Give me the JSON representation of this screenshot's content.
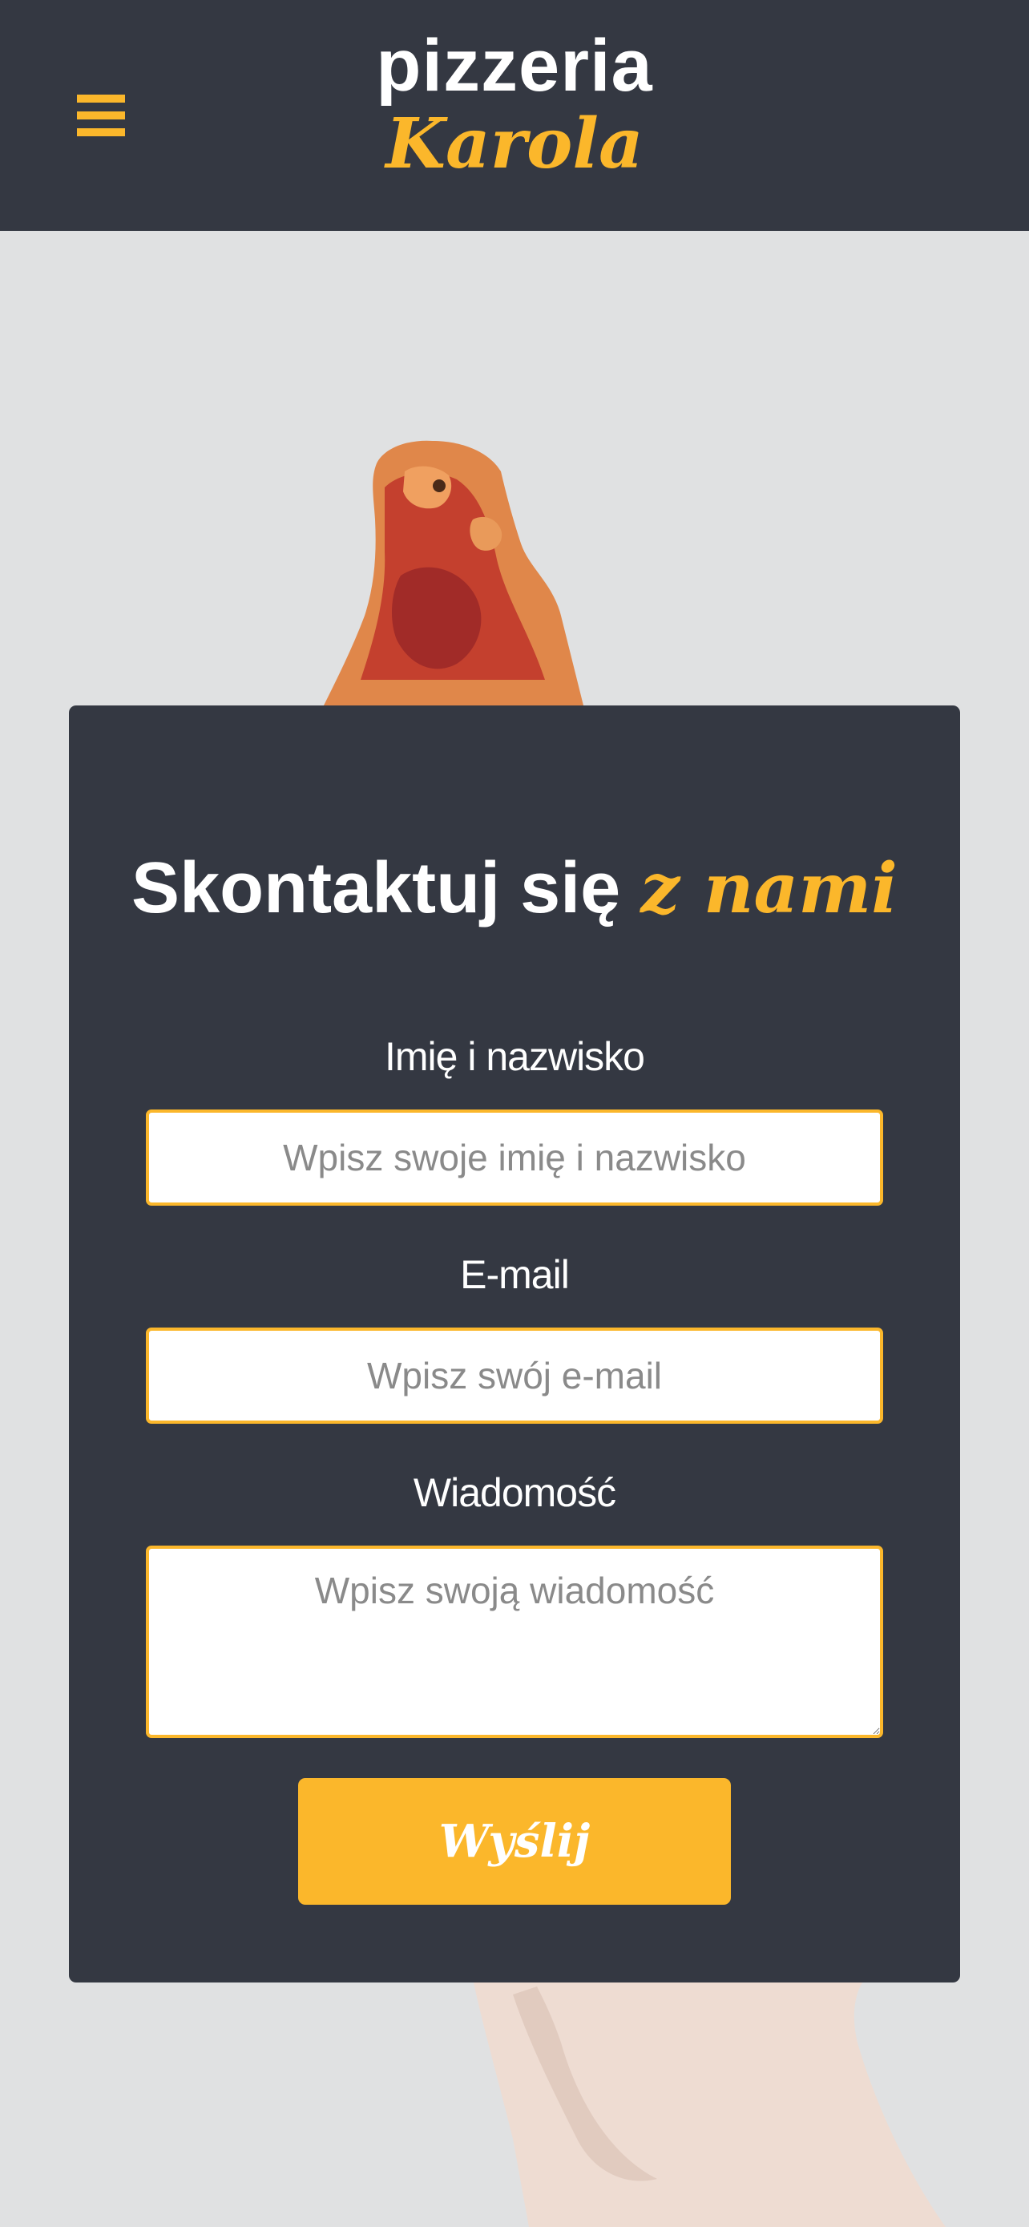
{
  "header": {
    "menu_icon": "hamburger-menu-icon",
    "brand_top": "pizzeria",
    "brand_bottom": "Karola"
  },
  "contact": {
    "title_main": "Skontaktuj się",
    "title_accent": "z nami",
    "name_label": "Imię i nazwisko",
    "name_placeholder": "Wpisz swoje imię i nazwisko",
    "name_value": "",
    "email_label": "E-mail",
    "email_placeholder": "Wpisz swój e-mail",
    "email_value": "",
    "message_label": "Wiadomość",
    "message_placeholder": "Wpisz swoją wiadomość",
    "message_value": "",
    "submit_label": "Wyślij"
  },
  "colors": {
    "dark": "#343842",
    "accent": "#fbb72b",
    "background": "#e0e1e2"
  }
}
